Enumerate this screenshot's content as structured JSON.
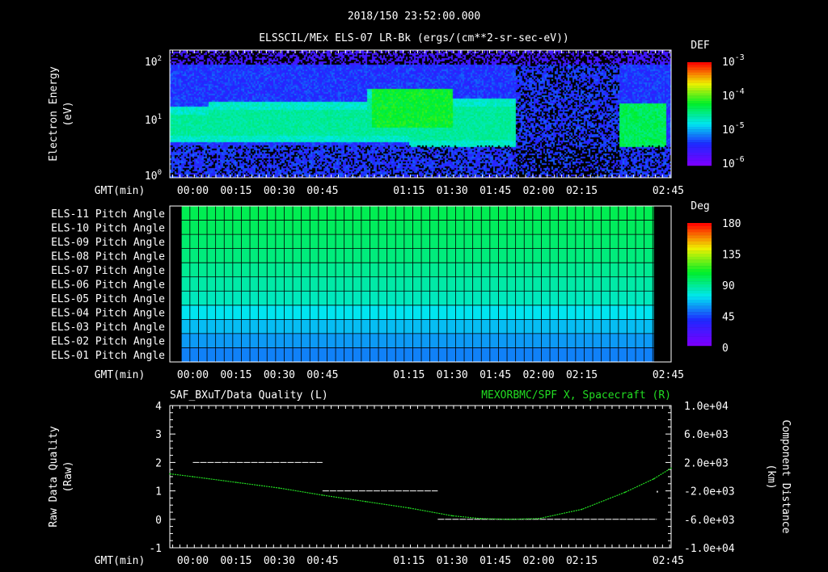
{
  "header": {
    "title": "2018/150 23:52:00.000",
    "subtitle": "ELSSCIL/MEx ELS-07 LR-Bk  (ergs/(cm**2-sr-sec-eV))"
  },
  "time_axis": {
    "label": "GMT(min)",
    "ticks": [
      "00:00",
      "00:15",
      "00:30",
      "00:45",
      "01:15",
      "01:30",
      "01:45",
      "02:00",
      "02:15",
      "02:45"
    ],
    "tick_minutes": [
      0,
      15,
      30,
      45,
      75,
      90,
      105,
      120,
      135,
      165
    ],
    "range_minutes": [
      -8,
      166
    ]
  },
  "chart_data": [
    {
      "type": "heatmap",
      "name": "spectrogram",
      "ylabel": "Electron Energy",
      "yunit": "(eV)",
      "yscale": "log",
      "ylim": [
        1,
        200
      ],
      "yticks": [
        "10^2",
        "10^1",
        "10^0"
      ],
      "colorbar": {
        "title": "DEF",
        "scale": "log",
        "range": [
          1e-06,
          0.001
        ],
        "ticks": [
          {
            "b": "10",
            "e": "-3"
          },
          {
            "b": "10",
            "e": "-4"
          },
          {
            "b": "10",
            "e": "-5"
          },
          {
            "b": "10",
            "e": "-6"
          }
        ]
      }
    },
    {
      "type": "heatmap",
      "name": "pitch-angle",
      "rows": [
        "ELS-11 Pitch Angle",
        "ELS-10 Pitch Angle",
        "ELS-09 Pitch Angle",
        "ELS-08 Pitch Angle",
        "ELS-07 Pitch Angle",
        "ELS-06 Pitch Angle",
        "ELS-05 Pitch Angle",
        "ELS-04 Pitch Angle",
        "ELS-03 Pitch Angle",
        "ELS-02 Pitch Angle",
        "ELS-01 Pitch Angle"
      ],
      "values_deg": [
        100,
        98,
        95,
        92,
        88,
        84,
        80,
        70,
        62,
        55,
        50
      ],
      "data_range_minutes": [
        -4,
        160
      ],
      "colorbar": {
        "title": "Deg",
        "range": [
          0,
          180
        ],
        "ticks": [
          "180",
          "135",
          "90",
          "45",
          "0"
        ]
      }
    },
    {
      "type": "line",
      "name": "quality-and-position",
      "left": {
        "title": "SAF_BXuT/Data Quality (L)",
        "ylabel": "Raw Data Quality",
        "yunit": "(Raw)",
        "ylim": [
          -1,
          4
        ],
        "yticks": [
          "4",
          "3",
          "2",
          "1",
          "0",
          "-1"
        ],
        "segments": [
          {
            "x": [
              0,
              45
            ],
            "y": 2
          },
          {
            "x": [
              45,
              85
            ],
            "y": 1
          },
          {
            "x": [
              85,
              161
            ],
            "y": 0
          }
        ],
        "points": [
          {
            "x": 161,
            "y": 1
          }
        ]
      },
      "right": {
        "title": "MEXORBMC/SPF X, Spacecraft (R)",
        "ylabel": "Component Distance",
        "yunit": "(km)",
        "ylim": [
          -10000,
          10000
        ],
        "yticks": [
          "1.0e+04",
          "6.0e+03",
          "2.0e+03",
          "-2.0e+03",
          "-6.0e+03",
          "-1.0e+04"
        ],
        "color": "#22dd22",
        "x": [
          -8,
          0,
          15,
          30,
          45,
          60,
          75,
          90,
          100,
          110,
          120,
          135,
          150,
          160,
          166
        ],
        "y": [
          400,
          0,
          -800,
          -1600,
          -2600,
          -3500,
          -4400,
          -5500,
          -5900,
          -6000,
          -5900,
          -4600,
          -2200,
          -300,
          1200
        ]
      }
    }
  ]
}
